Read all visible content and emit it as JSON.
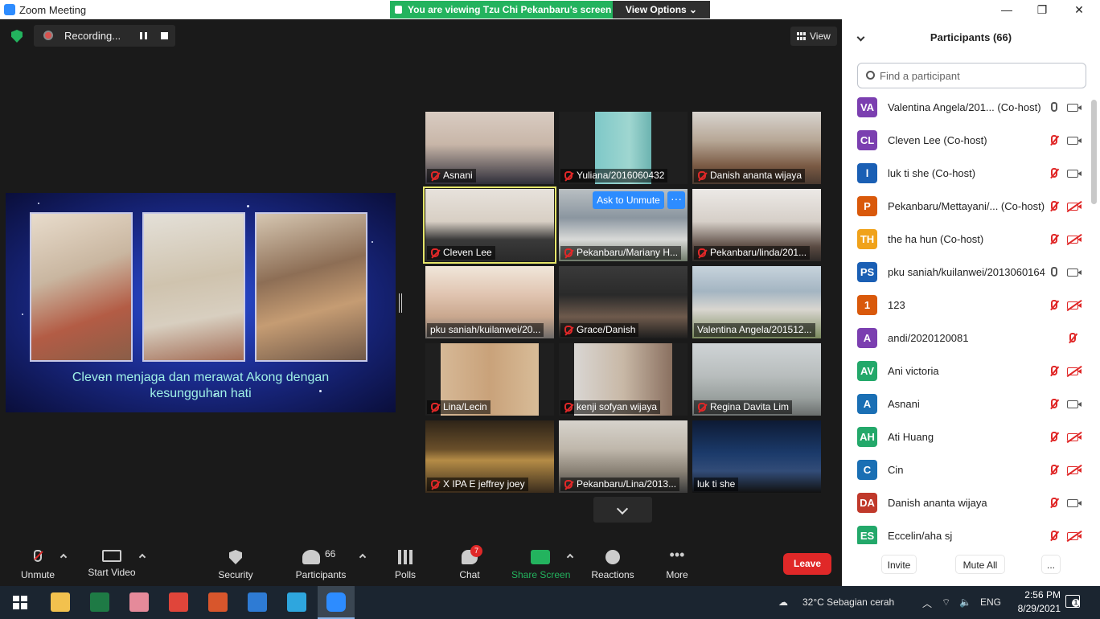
{
  "window": {
    "title": "Zoom Meeting",
    "controls": [
      "—",
      "❐",
      "✕"
    ]
  },
  "banner": {
    "viewing_text": "You are viewing Tzu Chi Pekanbaru's screen",
    "view_options_label": "View Options ⌄"
  },
  "recording": {
    "label": "Recording..."
  },
  "view_button": {
    "label": "View"
  },
  "shared_screen": {
    "caption_line1": "Cleven menjaga dan merawat Akong dengan",
    "caption_line2": "kesungguhan hati"
  },
  "gallery": {
    "ask_unmute_label": "Ask to Unmute",
    "more_label": "···",
    "tiles": [
      {
        "name": "Asnani",
        "muted": true,
        "bg": "linear-gradient(180deg,#d9ccc2 0%,#c8b6a8 45%,#2f2e3a 100%)"
      },
      {
        "name": "Yuliana/2016060432",
        "muted": true,
        "bg": "linear-gradient(90deg,#1f1f1f 0%,#1f1f1f 28%,#7ec8c8 28%,#9fd6d0 55%,#6bb3b0 72%,#1f1f1f 72%)"
      },
      {
        "name": "Danish ananta wijaya",
        "muted": true,
        "bg": "linear-gradient(180deg,#d8d4cf 0%,#b7a796 40%,#7a5a44 75%,#4a3a30 100%)"
      },
      {
        "name": "Cleven Lee",
        "muted": true,
        "speaking": true,
        "bg": "linear-gradient(180deg,#e7e2dc 0%,#d8cfc4 45%,#3a3a3a 70%,#2a2a2a 100%)"
      },
      {
        "name": "Pekanbaru/Mariany H...",
        "muted": true,
        "bg": "linear-gradient(180deg,#b9bfc2 0%,#8b96a0 40%,#d9dad8 70%,#6f7a6a 100%)"
      },
      {
        "name": "Pekanbaru/linda/201...",
        "muted": true,
        "bg": "linear-gradient(180deg,#ece9e6 0%,#d6cfc8 45%,#5a4a42 80%,#2e2a28 100%)"
      },
      {
        "name": "pku saniah/kuilanwei/20...",
        "muted": false,
        "bg": "linear-gradient(180deg,#f0e6da 0%,#e0c4b0 40%,#c9a78e 70%,#6d6a68 100%)"
      },
      {
        "name": "Grace/Danish",
        "muted": true,
        "bg": "linear-gradient(180deg,#3a3a3a 0%,#2a2a2a 40%,#6e5a4c 70%,#1e1e1e 100%)"
      },
      {
        "name": "Valentina Angela/201512...",
        "muted": false,
        "bg": "linear-gradient(180deg,#c7d3dc 0%,#a4b5c2 35%,#d9d6d0 60%,#7a8a5e 100%)"
      },
      {
        "name": "Lina/Lecin",
        "muted": true,
        "bg": "linear-gradient(90deg,#1f1f1f 0%,#1f1f1f 12%,#d6b896 12%,#c9a27a 50%,#d8bc98 88%,#1f1f1f 88%)"
      },
      {
        "name": "kenji sofyan wijaya",
        "muted": true,
        "bg": "linear-gradient(90deg,#1f1f1f 0%,#1f1f1f 12%,#d9d6d3 12%,#c8b8a6 50%,#8a7060 88%,#1f1f1f 88%)"
      },
      {
        "name": "Regina Davita Lim",
        "muted": true,
        "bg": "linear-gradient(180deg,#cfd4d6 0%,#b8bdbd 45%,#9aa19f 75%,#6a6e6d 100%)"
      },
      {
        "name": "X IPA E jeffrey joey",
        "muted": true,
        "bg": "linear-gradient(180deg,#2e2418 0%,#6a4f2a 40%,#b58c46 55%,#3a2c1c 100%)"
      },
      {
        "name": "Pekanbaru/Lina/2013...",
        "muted": true,
        "bg": "linear-gradient(180deg,#d7d3cc 0%,#bfb7ab 40%,#8a8276 70%,#3a3a3a 100%)"
      },
      {
        "name": "luk ti she",
        "muted": false,
        "bg": "linear-gradient(180deg,#0d1a34 0%,#1b3a6a 45%,#324c78 70%,#111 100%)"
      }
    ]
  },
  "toolbar": {
    "unmute": "Unmute",
    "start_video": "Start Video",
    "security": "Security",
    "participants": "Participants",
    "participants_count": "66",
    "polls": "Polls",
    "chat": "Chat",
    "chat_badge": "7",
    "share_screen": "Share Screen",
    "reactions": "Reactions",
    "more": "More",
    "leave": "Leave"
  },
  "panel": {
    "title": "Participants (66)",
    "search_placeholder": "Find a participant",
    "invite_label": "Invite",
    "mute_all_label": "Mute All",
    "more_label": "...",
    "participants": [
      {
        "initials": "VA",
        "color": "#7b3fb0",
        "name": "Valentina Angela/201...  (Co-host)",
        "mic": "on",
        "cam": "on"
      },
      {
        "initials": "CL",
        "color": "#7b3fb0",
        "name": "Cleven Lee (Co-host)",
        "mic": "off",
        "cam": "on"
      },
      {
        "initials": "l",
        "color": "#1a5fb4",
        "name": "luk ti she (Co-host)",
        "mic": "off",
        "cam": "on"
      },
      {
        "initials": "P",
        "color": "#d9590b",
        "name": "Pekanbaru/Mettayani/...  (Co-host)",
        "mic": "off",
        "cam": "off"
      },
      {
        "initials": "TH",
        "color": "#f0a21a",
        "name": "the ha hun (Co-host)",
        "mic": "off",
        "cam": "off"
      },
      {
        "initials": "PS",
        "color": "#1a5fb4",
        "name": "pku saniah/kuilanwei/2013060164",
        "mic": "on",
        "cam": "on"
      },
      {
        "initials": "1",
        "color": "#d9590b",
        "name": "123",
        "mic": "off",
        "cam": "off"
      },
      {
        "initials": "A",
        "color": "#7b3fb0",
        "name": "andi/2020120081",
        "mic": "off",
        "cam": "none"
      },
      {
        "initials": "AV",
        "color": "#23a86a",
        "name": "Ani victoria",
        "mic": "off",
        "cam": "off"
      },
      {
        "initials": "A",
        "color": "#1a6fb4",
        "name": "Asnani",
        "mic": "off",
        "cam": "on"
      },
      {
        "initials": "AH",
        "color": "#23a86a",
        "name": "Ati Huang",
        "mic": "off",
        "cam": "off"
      },
      {
        "initials": "C",
        "color": "#1a6fb4",
        "name": "Cin",
        "mic": "off",
        "cam": "off"
      },
      {
        "initials": "DA",
        "color": "#c0392b",
        "name": "Danish ananta wijaya",
        "mic": "off",
        "cam": "on"
      },
      {
        "initials": "ES",
        "color": "#23a86a",
        "name": "Eccelin/aha sj",
        "mic": "off",
        "cam": "off"
      }
    ]
  },
  "taskbar": {
    "weather": "32°C  Sebagian cerah",
    "lang": "ENG",
    "time": "2:56 PM",
    "date": "8/29/2021",
    "notifications": "1",
    "apps": [
      {
        "name": "file-explorer-icon",
        "color": "#f2c14e"
      },
      {
        "name": "excel-icon",
        "color": "#1e7a45"
      },
      {
        "name": "paint-icon",
        "color": "#e58a9a"
      },
      {
        "name": "chrome-icon",
        "color": "#e0453a"
      },
      {
        "name": "presentation-icon",
        "color": "#d8562c"
      },
      {
        "name": "edge-icon",
        "color": "#2e7bd4"
      },
      {
        "name": "telegram-icon",
        "color": "#2ea6de"
      },
      {
        "name": "zoom-icon",
        "color": "#2d8cff"
      }
    ]
  }
}
